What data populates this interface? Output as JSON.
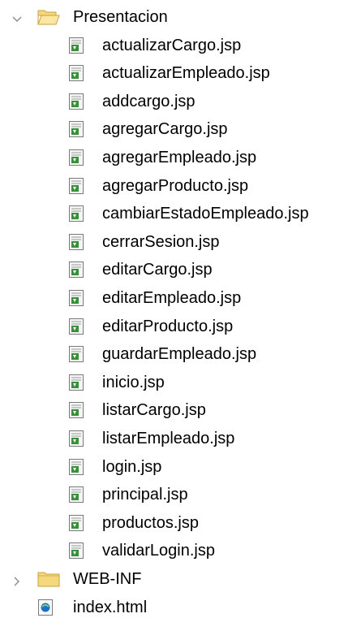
{
  "tree": {
    "presentacion": {
      "label": "Presentacion",
      "expanded": true,
      "files": [
        "actualizarCargo.jsp",
        "actualizarEmpleado.jsp",
        "addcargo.jsp",
        "agregarCargo.jsp",
        "agregarEmpleado.jsp",
        "agregarProducto.jsp",
        "cambiarEstadoEmpleado.jsp",
        "cerrarSesion.jsp",
        "editarCargo.jsp",
        "editarEmpleado.jsp",
        "editarProducto.jsp",
        "guardarEmpleado.jsp",
        "inicio.jsp",
        "listarCargo.jsp",
        "listarEmpleado.jsp",
        "login.jsp",
        "principal.jsp",
        "productos.jsp",
        "validarLogin.jsp"
      ]
    },
    "webinf": {
      "label": "WEB-INF",
      "expanded": false
    },
    "index": {
      "label": "index.html"
    }
  },
  "icons": {
    "folder_open": "folder-open-icon",
    "folder_closed": "folder-icon",
    "jsp": "jsp-file-icon",
    "html": "html-file-icon",
    "expanded": "chevron-down-icon",
    "collapsed": "chevron-right-icon"
  },
  "colors": {
    "folder_fill": "#F5D77C",
    "folder_stroke": "#C9A23E",
    "chevron": "#8A8A8A",
    "jsp_green": "#3A8F3A",
    "html_blue": "#1E6FC8"
  }
}
